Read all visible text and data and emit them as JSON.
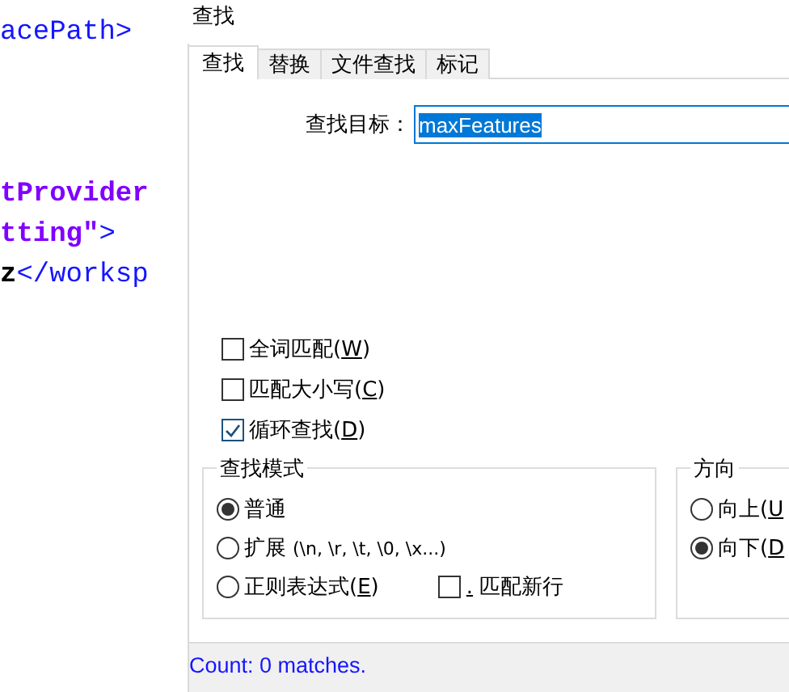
{
  "code_blocks": [
    [
      [
        {
          "kind": "tag",
          "text": "acePath>"
        }
      ]
    ],
    [
      [
        {
          "kind": "attr",
          "text": "tProvider"
        }
      ],
      [
        {
          "kind": "attr",
          "text": "tting\""
        },
        {
          "kind": "tag",
          "text": ">"
        }
      ],
      [
        {
          "kind": "content",
          "text": "z"
        },
        {
          "kind": "tag",
          "text": "</worksp"
        }
      ]
    ]
  ],
  "window": {
    "title": "查找"
  },
  "tabs": [
    {
      "label": "查找",
      "selected": true
    },
    {
      "label": "替换",
      "selected": false
    },
    {
      "label": "文件查找",
      "selected": false
    },
    {
      "label": "标记",
      "selected": false
    }
  ],
  "search": {
    "label": "查找目标：",
    "value": "maxFeatures"
  },
  "options": [
    {
      "prefix": "全词匹配(",
      "key": "W",
      "suffix": ")",
      "checked": false
    },
    {
      "prefix": "匹配大小写(",
      "key": "C",
      "suffix": ")",
      "checked": false
    },
    {
      "prefix": "循环查找(",
      "key": "D",
      "suffix": ")",
      "checked": true
    }
  ],
  "search_mode": {
    "title": "查找模式",
    "modes": [
      {
        "prefix": "普通",
        "selected": true
      },
      {
        "prefix": "扩展",
        "hint": "(\\n, \\r, \\t, \\0, \\x...)",
        "selected": false
      },
      {
        "prefix": "正则表达式(",
        "key": "E",
        "suffix": ")",
        "selected": false
      }
    ],
    "newline_option": {
      "key": ".",
      "suffix": " 匹配新行",
      "checked": false
    }
  },
  "direction": {
    "title": "方向",
    "options": [
      {
        "prefix": "向上(",
        "key": "U",
        "selected": false
      },
      {
        "prefix": "向下(",
        "key": "D",
        "selected": true
      }
    ]
  },
  "status_bar": "Count: 0 matches."
}
